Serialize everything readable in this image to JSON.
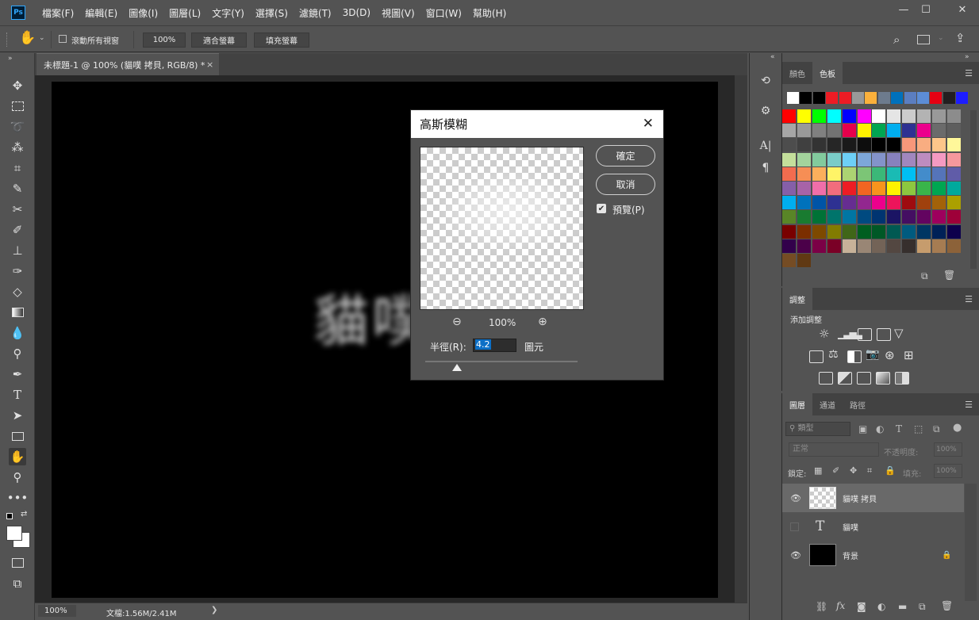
{
  "app": {
    "logo": "Ps",
    "menu": [
      "檔案(F)",
      "編輯(E)",
      "圖像(I)",
      "圖層(L)",
      "文字(Y)",
      "選擇(S)",
      "濾鏡(T)",
      "3D(D)",
      "視圖(V)",
      "窗口(W)",
      "幫助(H)"
    ],
    "window_controls": {
      "minimize": "—",
      "maximize": "☐",
      "close": "✕"
    }
  },
  "options_bar": {
    "scroll_all_label": "滾動所有視窗",
    "zoom_value": "100%",
    "fit_screen": "適合螢幕",
    "fill_screen": "填充螢幕"
  },
  "document": {
    "tab_title": "未標題-1 @ 100% (貓噗 拷貝, RGB/8) *",
    "tab_close": "×",
    "canvas_text": "貓噗"
  },
  "status": {
    "zoom": "100%",
    "doc_info": "文檔:1.56M/2.41M",
    "arrow": "❯"
  },
  "swatches_panel": {
    "tabs": [
      "顏色",
      "色板"
    ],
    "active_tab": "色板",
    "rows": [
      [
        "#ffffff",
        "#000000",
        "#000000",
        "#ed1c24",
        "#ed1c24",
        "#999999",
        "#fbb03b",
        "#6d7b8d",
        "#0071bc",
        "#5b7ec0",
        "#5c8dd6",
        "#e60012",
        "#231f20",
        "#1d1dff"
      ],
      [
        "#ff0000",
        "#ffff00",
        "#00ff00",
        "#00ffff",
        "#0000ff",
        "#ff00ff",
        "#ffffff",
        "#e5e5e5",
        "#cccccc",
        "#b3b3b3",
        "#999999",
        "#8c8c8c"
      ],
      [
        "#a6a6a6",
        "#999999",
        "#808080",
        "#737373",
        "#e6004c",
        "#fff200",
        "#00a651",
        "#00aeef",
        "#2e3192",
        "#ec008c",
        "#6b6b6b",
        "#5e5e5e"
      ],
      [
        "#4d4d4d",
        "#404040",
        "#333333",
        "#262626",
        "#1a1a1a",
        "#0d0d0d",
        "#000000",
        "#000000",
        "#f7977a",
        "#f9ad81",
        "#fdc68a",
        "#fff79a"
      ],
      [
        "#c4df9b",
        "#a3d39c",
        "#82ca9d",
        "#7accc8",
        "#6dcff6",
        "#7da7d9",
        "#8393ca",
        "#8781bd",
        "#a187be",
        "#bd8cbf",
        "#f49ac2",
        "#f6989d"
      ],
      [
        "#f26c4f",
        "#f68e55",
        "#fbaf5c",
        "#fff467",
        "#acd372",
        "#7cc576",
        "#3bb878",
        "#1abbb4",
        "#00bff3",
        "#438ccb",
        "#5574b9",
        "#605ca8"
      ],
      [
        "#855fa8",
        "#a763a8",
        "#f06ea9",
        "#f26d7d",
        "#ed1c24",
        "#f26522",
        "#f7941d",
        "#fff200",
        "#8dc73f",
        "#39b54a",
        "#00a651",
        "#00a99d"
      ],
      [
        "#00aeef",
        "#0072bc",
        "#0054a6",
        "#2e3192",
        "#662d91",
        "#92278f",
        "#ec008c",
        "#ed145b",
        "#9e0b0f",
        "#a0410d",
        "#a36209",
        "#aba000"
      ],
      [
        "#598527",
        "#197b30",
        "#007236",
        "#00746b",
        "#0076a3",
        "#004a80",
        "#003471",
        "#1b1464",
        "#440e62",
        "#630460",
        "#9e005d",
        "#9e0039"
      ],
      [
        "#790000",
        "#7b2e00",
        "#7d4900",
        "#827b00",
        "#406618",
        "#005e20",
        "#005826",
        "#005952",
        "#005b7f",
        "#003663",
        "#002157",
        "#0d004c"
      ],
      [
        "#32004b",
        "#4b0049",
        "#7b0046",
        "#7a0026",
        "#c7b299",
        "#998675",
        "#736357",
        "#534741",
        "#362f2d",
        "#c69c6d",
        "#a67c52",
        "#8c6239"
      ],
      [
        "#754c24",
        "#603913"
      ]
    ]
  },
  "adjustments_panel": {
    "tab": "調整",
    "subtitle": "添加調整"
  },
  "layers_panel": {
    "tabs": [
      "圖層",
      "通道",
      "路徑"
    ],
    "active_tab": "圖層",
    "filter_label": "類型",
    "blend_mode": "正常",
    "opacity_label": "不透明度:",
    "opacity_value": "100%",
    "lock_label": "鎖定:",
    "fill_label": "填充:",
    "fill_value": "100%",
    "layers": [
      {
        "name": "貓噗 拷貝",
        "kind": "pixel",
        "visible": true,
        "selected": true
      },
      {
        "name": "貓噗",
        "kind": "text",
        "visible": false,
        "selected": false
      },
      {
        "name": "背景",
        "kind": "background",
        "visible": true,
        "selected": false
      }
    ]
  },
  "dialog": {
    "title": "高斯模糊",
    "ok": "確定",
    "cancel": "取消",
    "preview_label": "預覽(P)",
    "preview_checked": true,
    "zoom": "100%",
    "radius_label": "半徑(R):",
    "radius_value": "4.2",
    "radius_unit": "圖元",
    "radius_fraction": 0.21
  }
}
